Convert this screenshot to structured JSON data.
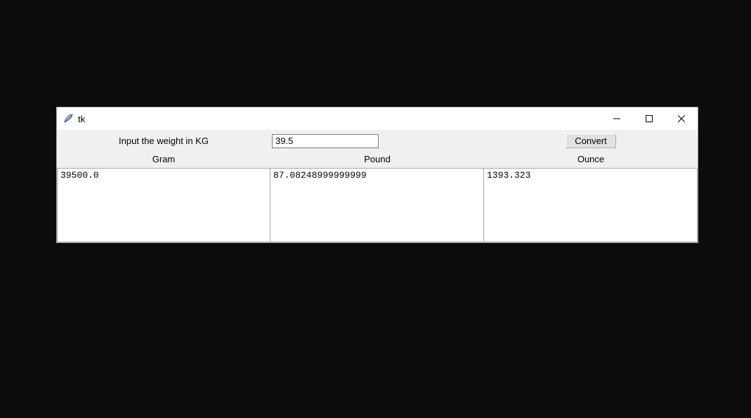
{
  "window": {
    "title": "tk",
    "icon_name": "feather-icon"
  },
  "controls": {
    "input_label": "Input the weight in KG",
    "input_value": "39.5",
    "convert_label": "Convert"
  },
  "headers": {
    "col1": "Gram",
    "col2": "Pound",
    "col3": "Ounce"
  },
  "results": {
    "gram": "39500.0",
    "pound": "87.08248999999999",
    "ounce": "1393.323"
  }
}
